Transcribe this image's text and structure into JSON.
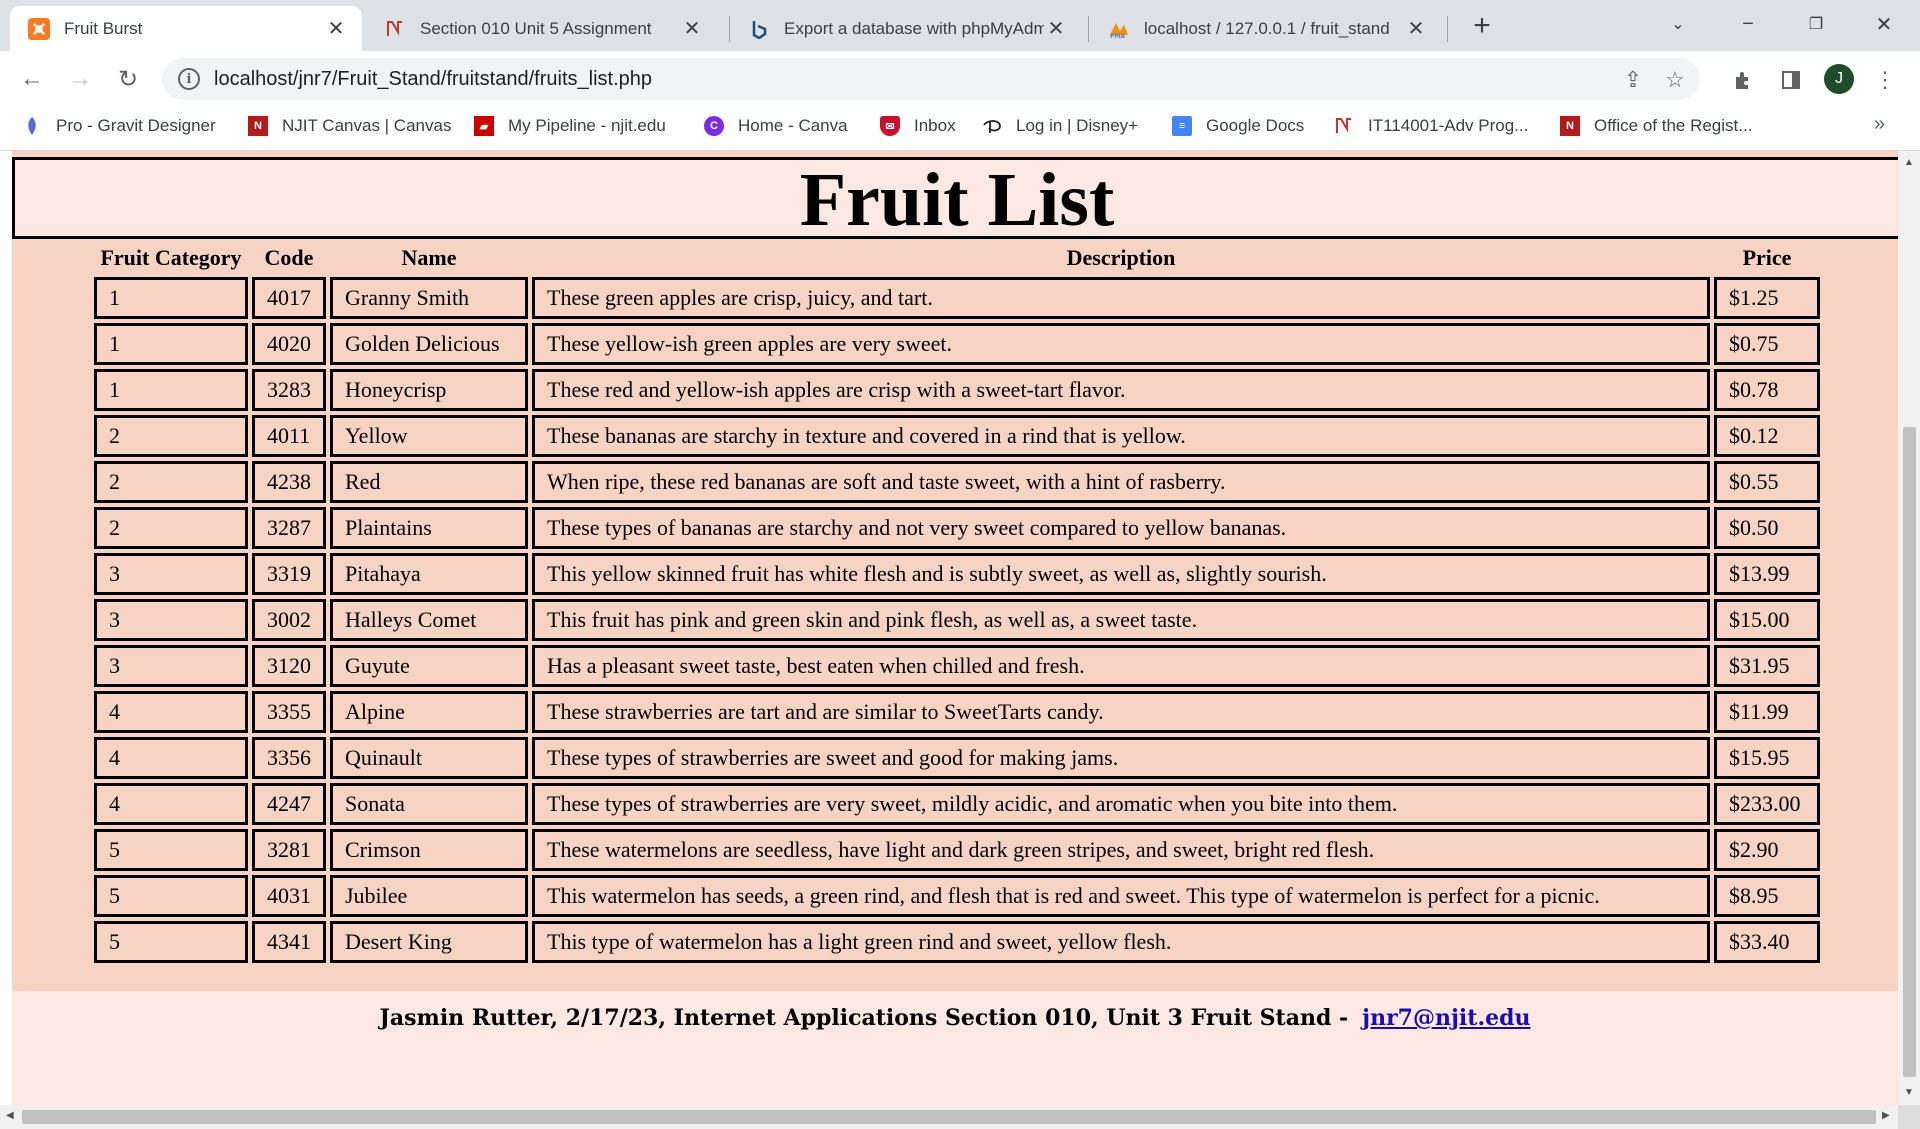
{
  "browser": {
    "tabs": [
      {
        "title": "Fruit Burst",
        "icon": "xampp-icon",
        "active": true
      },
      {
        "title": "Section 010 Unit 5 Assignment",
        "icon": "njit-canvas-icon",
        "active": false
      },
      {
        "title": "Export a database with phpMyAdmin",
        "icon": "bing-icon",
        "active": false
      },
      {
        "title": "localhost / 127.0.0.1 / fruit_stand",
        "icon": "phpmyadmin-icon",
        "active": false
      }
    ],
    "url": "localhost/jnr7/Fruit_Stand/fruitstand/fruits_list.php",
    "profile_initial": "J",
    "bookmarks": [
      {
        "label": "Pro - Gravit Designer",
        "icon": "gravit-icon",
        "color": "#5b6bd6"
      },
      {
        "label": "NJIT Canvas | Canvas",
        "icon": "njit-icon",
        "color": "#b31b1b"
      },
      {
        "label": "My Pipeline - njit.edu",
        "icon": "pipeline-icon",
        "color": "#cc0000"
      },
      {
        "label": "Home - Canva",
        "icon": "canva-icon",
        "color": "#7d2ae8"
      },
      {
        "label": "Inbox",
        "icon": "inbox-icon",
        "color": "#c8102e"
      },
      {
        "label": "Log in | Disney+",
        "icon": "disney-icon",
        "color": "#113ccf"
      },
      {
        "label": "Google Docs",
        "icon": "google-docs-icon",
        "color": "#4285f4"
      },
      {
        "label": "IT114001-Adv Prog...",
        "icon": "njit-canvas-icon",
        "color": "#b31b1b"
      },
      {
        "label": "Office of the Regist...",
        "icon": "njit-icon",
        "color": "#b31b1b"
      }
    ]
  },
  "page": {
    "heading": "Fruit List",
    "columns": [
      "Fruit Category",
      "Code",
      "Name",
      "Description",
      "Price"
    ],
    "rows": [
      [
        "1",
        "4017",
        "Granny Smith",
        "These green apples are crisp, juicy, and tart.",
        "$1.25"
      ],
      [
        "1",
        "4020",
        "Golden Delicious",
        "These yellow-ish green apples are very sweet.",
        "$0.75"
      ],
      [
        "1",
        "3283",
        "Honeycrisp",
        "These red and yellow-ish apples are crisp with a sweet-tart flavor.",
        "$0.78"
      ],
      [
        "2",
        "4011",
        "Yellow",
        "These bananas are starchy in texture and covered in a rind that is yellow.",
        "$0.12"
      ],
      [
        "2",
        "4238",
        "Red",
        "When ripe, these red bananas are soft and taste sweet, with a hint of rasberry.",
        "$0.55"
      ],
      [
        "2",
        "3287",
        "Plaintains",
        "These types of bananas are starchy and not very sweet compared to yellow bananas.",
        "$0.50"
      ],
      [
        "3",
        "3319",
        "Pitahaya",
        "This yellow skinned fruit has white flesh and is subtly sweet, as well as, slightly sourish.",
        "$13.99"
      ],
      [
        "3",
        "3002",
        "Halleys Comet",
        "This fruit has pink and green skin and pink flesh, as well as, a sweet taste.",
        "$15.00"
      ],
      [
        "3",
        "3120",
        "Guyute",
        "Has a pleasant sweet taste, best eaten when chilled and fresh.",
        "$31.95"
      ],
      [
        "4",
        "3355",
        "Alpine",
        "These strawberries are tart and are similar to SweetTarts candy.",
        "$11.99"
      ],
      [
        "4",
        "3356",
        "Quinault",
        "These types of strawberries are sweet and good for making jams.",
        "$15.95"
      ],
      [
        "4",
        "4247",
        "Sonata",
        "These types of strawberries are very sweet, mildly acidic, and aromatic when you bite into them.",
        "$233.00"
      ],
      [
        "5",
        "3281",
        "Crimson",
        "These watermelons are seedless, have light and dark green stripes, and sweet, bright red flesh.",
        "$2.90"
      ],
      [
        "5",
        "4031",
        "Jubilee",
        "This watermelon has seeds, a green rind, and flesh that is red and sweet. This type of watermelon is perfect for a picnic.",
        "$8.95"
      ],
      [
        "5",
        "4341",
        "Desert King",
        "This type of watermelon has a light green rind and sweet, yellow flesh.",
        "$33.40"
      ]
    ],
    "footer": {
      "text": "Jasmin Rutter, 2/17/23, Internet Applications Section 010, Unit 3 Fruit Stand -",
      "email": "jnr7@njit.edu"
    }
  },
  "colors": {
    "page_background": "#f7d3c3",
    "banner_background": "#fce8e2",
    "link": "#1a0dab"
  }
}
